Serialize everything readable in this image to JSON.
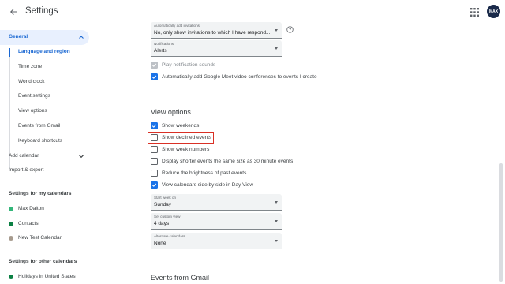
{
  "header": {
    "title": "Settings",
    "avatar_text": "MAX",
    "icons": {
      "back": "arrow-back-icon",
      "apps": "apps-grid-icon"
    }
  },
  "sidebar": {
    "general": "General",
    "general_items": [
      "Language and region",
      "Time zone",
      "World clock",
      "Event settings",
      "View options",
      "Events from Gmail",
      "Keyboard shortcuts"
    ],
    "add_calendar": "Add calendar",
    "import_export": "Import & export",
    "my_calendars_heading": "Settings for my calendars",
    "my_calendars": [
      {
        "name": "Max Dalton",
        "color": "#33b679"
      },
      {
        "name": "Contacts",
        "color": "#0b8043"
      },
      {
        "name": "New Test Calendar",
        "color": "#a79b8e"
      }
    ],
    "other_calendars_heading": "Settings for other calendars",
    "other_calendars": [
      {
        "name": "Holidays in United States",
        "color": "#0b8043"
      }
    ]
  },
  "main": {
    "invitations_select": {
      "caption": "Automatically add invitations",
      "value": "No, only show invitations to which I have respond..."
    },
    "notifications_select": {
      "caption": "Notifications",
      "value": "Alerts"
    },
    "play_sounds": {
      "label": "Play notification sounds",
      "checked": true,
      "disabled": true
    },
    "auto_meet": {
      "label": "Automatically add Google Meet video conferences to events I create",
      "checked": true
    },
    "view_options_title": "View options",
    "view_options": [
      {
        "label": "Show weekends",
        "checked": true
      },
      {
        "label": "Show declined events",
        "checked": false
      },
      {
        "label": "Show week numbers",
        "checked": false
      },
      {
        "label": "Display shorter events the same size as 30 minute events",
        "checked": false
      },
      {
        "label": "Reduce the brightness of past events",
        "checked": false
      },
      {
        "label": "View calendars side by side in Day View",
        "checked": true
      }
    ],
    "start_week_select": {
      "caption": "Start week on",
      "value": "Sunday"
    },
    "custom_view_select": {
      "caption": "Set custom view",
      "value": "4 days"
    },
    "alternate_select": {
      "caption": "Alternate calendars",
      "value": "None"
    },
    "events_from_gmail_title": "Events from Gmail"
  },
  "colors": {
    "accent": "#1a73e8",
    "active_text": "#1967d2",
    "highlight": "#d93025"
  }
}
